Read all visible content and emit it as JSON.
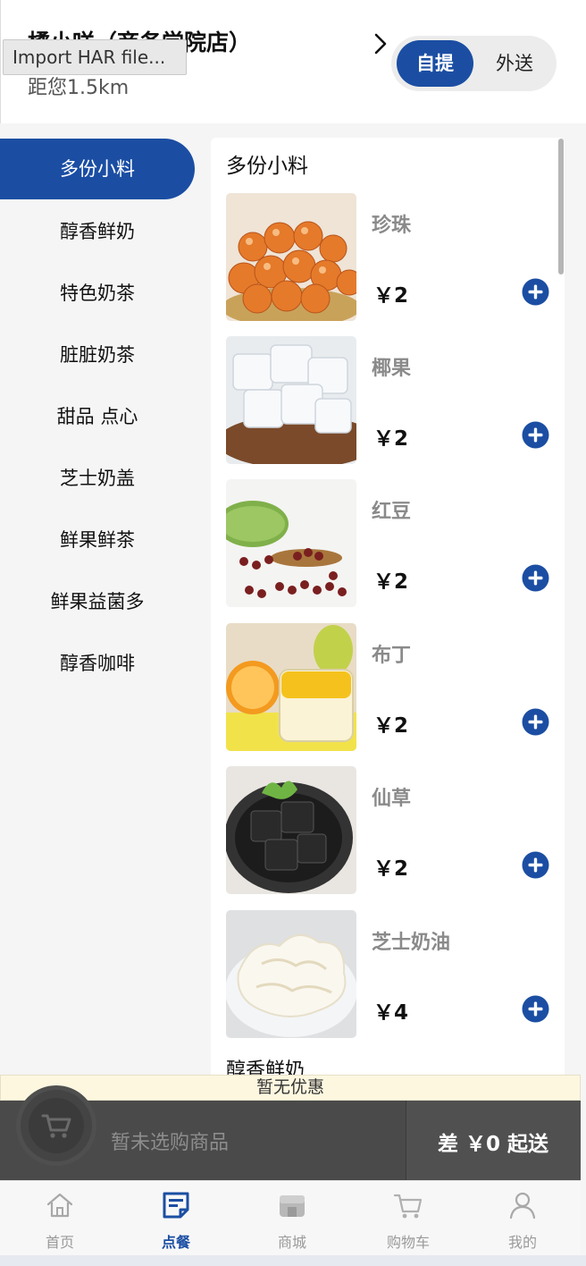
{
  "header": {
    "store_name": "橘小咩（商务学院店）",
    "distance": "距您1.5km",
    "har_tooltip": "Import HAR file...",
    "mode_pickup": "自提",
    "mode_delivery": "外送"
  },
  "sidebar": {
    "categories": [
      {
        "label": "多份小料",
        "active": true
      },
      {
        "label": "醇香鲜奶",
        "active": false
      },
      {
        "label": "特色奶茶",
        "active": false
      },
      {
        "label": "脏脏奶茶",
        "active": false
      },
      {
        "label": "甜品 点心",
        "active": false
      },
      {
        "label": "芝士奶盖",
        "active": false
      },
      {
        "label": "鲜果鲜茶",
        "active": false
      },
      {
        "label": "鲜果益菌多",
        "active": false
      },
      {
        "label": "醇香咖啡",
        "active": false
      }
    ]
  },
  "menu": {
    "section_title": "多份小料",
    "next_section_title": "醇香鲜奶",
    "products": [
      {
        "name": "珍珠",
        "price": "￥2"
      },
      {
        "name": "椰果",
        "price": "￥2"
      },
      {
        "name": "红豆",
        "price": "￥2"
      },
      {
        "name": "布丁",
        "price": "￥2"
      },
      {
        "name": "仙草",
        "price": "￥2"
      },
      {
        "name": "芝士奶油",
        "price": "￥4"
      }
    ]
  },
  "cart": {
    "promo": "暂无优惠",
    "empty_text": "暂未选购商品",
    "min_order": "差 ￥0 起送"
  },
  "tabbar": {
    "tabs": [
      {
        "label": "首页",
        "icon": "home-icon",
        "active": false
      },
      {
        "label": "点餐",
        "icon": "order-icon",
        "active": true
      },
      {
        "label": "商城",
        "icon": "shop-icon",
        "active": false
      },
      {
        "label": "购物车",
        "icon": "cart-icon",
        "active": false
      },
      {
        "label": "我的",
        "icon": "profile-icon",
        "active": false
      }
    ]
  },
  "colors": {
    "accent": "#1b4ea3",
    "cart_bar": "#4a4a4a",
    "promo_bg": "#fdf7e0"
  }
}
